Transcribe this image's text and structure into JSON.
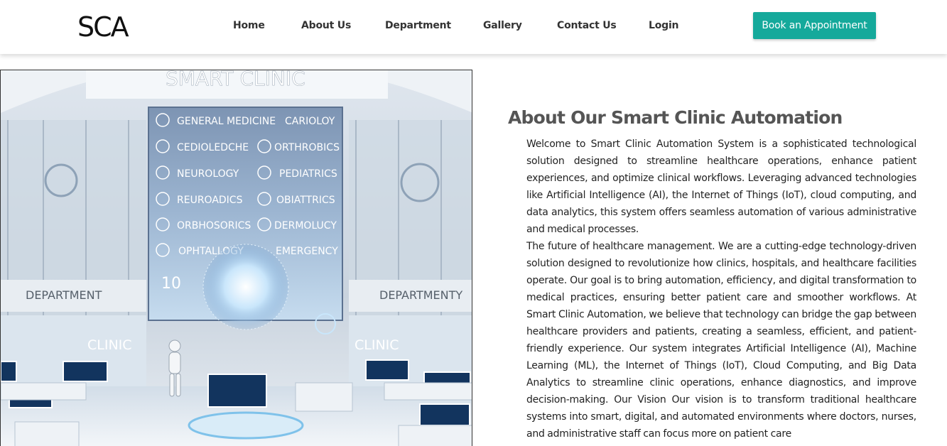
{
  "header": {
    "brand": "SCA",
    "nav": [
      {
        "label": "Home"
      },
      {
        "label": "About Us"
      },
      {
        "label": "Department"
      },
      {
        "label": "Gallery"
      },
      {
        "label": "Contact Us"
      },
      {
        "label": "Login"
      }
    ],
    "cta_label": "Book an Appointment"
  },
  "hero": {
    "sign_title": "SMART CLINIC",
    "departments": [
      "GENERAL MEDICINE",
      "CARIOLOY",
      "CEDIOLEDCHE",
      "ORTHROBICS",
      "NEUROLOGY",
      "PEDIATRICS",
      "REUROADICS",
      "OBIATTRICS",
      "ORBHOSORICS",
      "DERMOLUCY",
      "OPHTALLOGY",
      "EMERGENCY"
    ],
    "counter": "10",
    "left_sign": "DEPARTMENT",
    "right_sign": "DEPARTMENTY",
    "left_clinic": "CLINIC",
    "right_clinic": "CLINIC"
  },
  "about": {
    "title": "About Our Smart Clinic Automation",
    "paragraphs": [
      "Welcome to Smart Clinic Automation System is a sophisticated technological solution designed to streamline healthcare operations, enhance patient experiences, and optimize clinical workflows. Leveraging advanced technologies like Artificial Intelligence (AI), the Internet of Things (IoT), cloud computing, and data analytics, this system offers seamless automation of various administrative and medical processes.",
      "The future of healthcare management. We are a cutting-edge technology-driven solution designed to revolutionize how clinics, hospitals, and healthcare facilities operate. Our goal is to bring automation, efficiency, and digital transformation to medical practices, ensuring better patient care and smoother workflows. At Smart Clinic Automation, we believe that technology can bridge the gap between healthcare providers and patients, creating a seamless, efficient, and patient-friendly experience. Our system integrates Artificial Intelligence (AI), Machine Learning (ML), the Internet of Things (IoT), Cloud Computing, and Big Data Analytics to streamline clinic operations, enhance diagnostics, and improve decision-making. Our Vision Our vision is to transform traditional healthcare systems into smart, digital, and automated environments where doctors, nurses, and administrative staff can focus more on patient care"
    ]
  },
  "colors": {
    "accent": "#15a99b",
    "title_gray": "#555555"
  }
}
